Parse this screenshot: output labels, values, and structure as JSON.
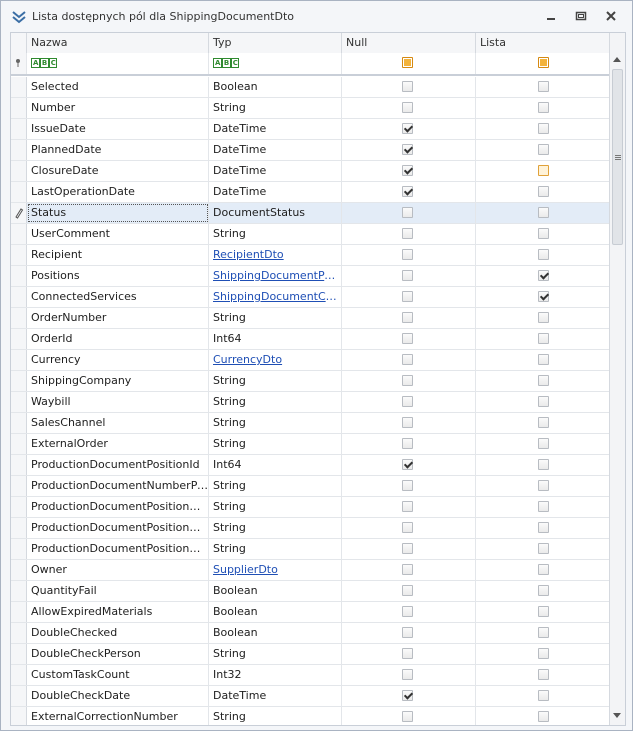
{
  "window": {
    "title": "Lista dostępnych pól dla ShippingDocumentDto",
    "icon": "double-chevron-down-icon",
    "buttons": [
      "minimize-icon",
      "restore-icon",
      "close-icon"
    ]
  },
  "columns": {
    "name": "Nazwa",
    "type": "Typ",
    "null": "Null",
    "list": "Lista"
  },
  "filter": {
    "name_icon": "text-filter-icon",
    "type_icon": "text-filter-icon",
    "null_state": "indeterminate",
    "list_state": "indeterminate"
  },
  "colors": {
    "link": "#1f4fb5",
    "selected_row": "#e3ecf7",
    "indeterminate": "#f3b33b"
  },
  "rows": [
    {
      "name": "Selected",
      "type": "Boolean",
      "type_is_link": false,
      "null": false,
      "list": false
    },
    {
      "name": "Number",
      "type": "String",
      "type_is_link": false,
      "null": false,
      "list": false
    },
    {
      "name": "IssueDate",
      "type": "DateTime",
      "type_is_link": false,
      "null": true,
      "list": false
    },
    {
      "name": "PlannedDate",
      "type": "DateTime",
      "type_is_link": false,
      "null": true,
      "list": false
    },
    {
      "name": "ClosureDate",
      "type": "DateTime",
      "type_is_link": false,
      "null": true,
      "list": false,
      "list_highlight": true
    },
    {
      "name": "LastOperationDate",
      "type": "DateTime",
      "type_is_link": false,
      "null": true,
      "list": false
    },
    {
      "name": "Status",
      "type": "DocumentStatus",
      "type_is_link": false,
      "null": false,
      "list": false,
      "selected": true,
      "editing": true
    },
    {
      "name": "UserComment",
      "type": "String",
      "type_is_link": false,
      "null": false,
      "list": false
    },
    {
      "name": "Recipient",
      "type": "RecipientDto",
      "type_is_link": true,
      "null": false,
      "list": false
    },
    {
      "name": "Positions",
      "type": "ShippingDocumentPositi...",
      "type_is_link": true,
      "null": false,
      "list": true
    },
    {
      "name": "ConnectedServices",
      "type": "ShippingDocumentConn...",
      "type_is_link": true,
      "null": false,
      "list": true
    },
    {
      "name": "OrderNumber",
      "type": "String",
      "type_is_link": false,
      "null": false,
      "list": false
    },
    {
      "name": "OrderId",
      "type": "Int64",
      "type_is_link": false,
      "null": false,
      "list": false
    },
    {
      "name": "Currency",
      "type": "CurrencyDto",
      "type_is_link": true,
      "null": false,
      "list": false
    },
    {
      "name": "ShippingCompany",
      "type": "String",
      "type_is_link": false,
      "null": false,
      "list": false
    },
    {
      "name": "Waybill",
      "type": "String",
      "type_is_link": false,
      "null": false,
      "list": false
    },
    {
      "name": "SalesChannel",
      "type": "String",
      "type_is_link": false,
      "null": false,
      "list": false
    },
    {
      "name": "ExternalOrder",
      "type": "String",
      "type_is_link": false,
      "null": false,
      "list": false
    },
    {
      "name": "ProductionDocumentPositionId",
      "type": "Int64",
      "type_is_link": false,
      "null": true,
      "list": false
    },
    {
      "name": "ProductionDocumentNumberPosition",
      "type": "String",
      "type_is_link": false,
      "null": false,
      "list": false
    },
    {
      "name": "ProductionDocumentPositionMater...",
      "type": "String",
      "type_is_link": false,
      "null": false,
      "list": false
    },
    {
      "name": "ProductionDocumentPositionMater...",
      "type": "String",
      "type_is_link": false,
      "null": false,
      "list": false
    },
    {
      "name": "ProductionDocumentPositionMater...",
      "type": "String",
      "type_is_link": false,
      "null": false,
      "list": false
    },
    {
      "name": "Owner",
      "type": "SupplierDto",
      "type_is_link": true,
      "null": false,
      "list": false
    },
    {
      "name": "QuantityFail",
      "type": "Boolean",
      "type_is_link": false,
      "null": false,
      "list": false
    },
    {
      "name": "AllowExpiredMaterials",
      "type": "Boolean",
      "type_is_link": false,
      "null": false,
      "list": false
    },
    {
      "name": "DoubleChecked",
      "type": "Boolean",
      "type_is_link": false,
      "null": false,
      "list": false
    },
    {
      "name": "DoubleCheckPerson",
      "type": "String",
      "type_is_link": false,
      "null": false,
      "list": false
    },
    {
      "name": "CustomTaskCount",
      "type": "Int32",
      "type_is_link": false,
      "null": false,
      "list": false
    },
    {
      "name": "DoubleCheckDate",
      "type": "DateTime",
      "type_is_link": false,
      "null": true,
      "list": false
    },
    {
      "name": "ExternalCorrectionNumber",
      "type": "String",
      "type_is_link": false,
      "null": false,
      "list": false
    }
  ]
}
